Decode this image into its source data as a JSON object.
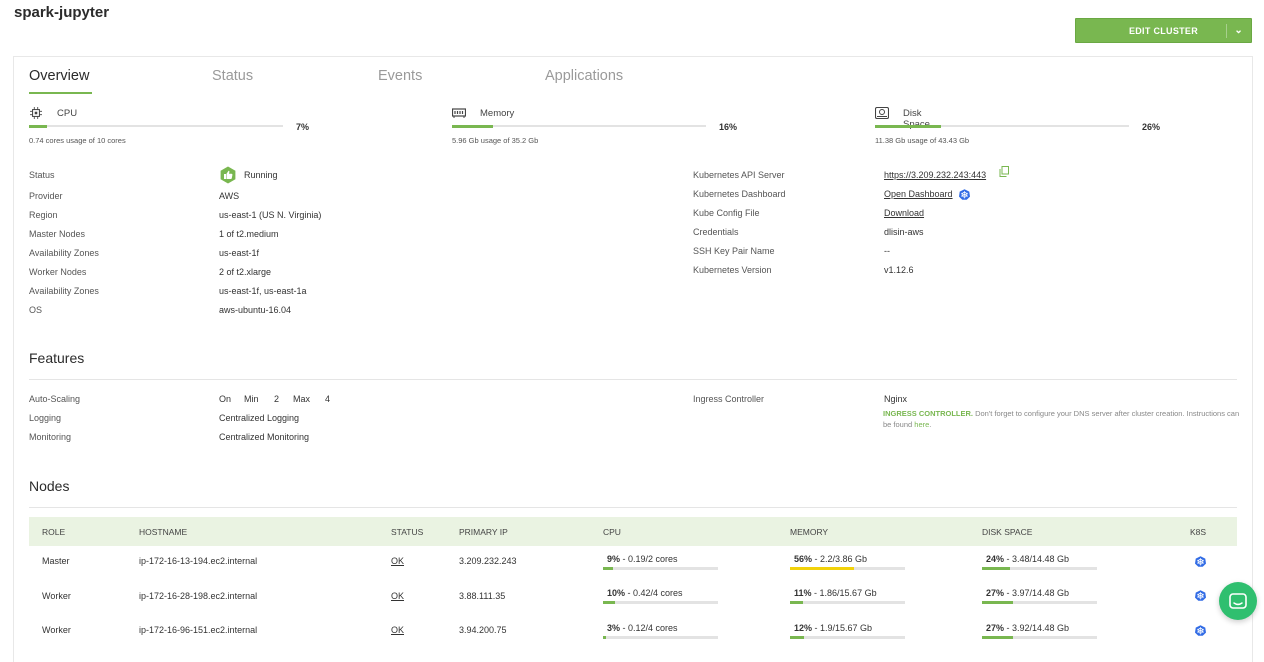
{
  "page": {
    "title": "spark-jupyter"
  },
  "header": {
    "edit_label": "EDIT CLUSTER"
  },
  "tabs": [
    {
      "label": "Overview",
      "active": true
    },
    {
      "label": "Status",
      "active": false
    },
    {
      "label": "Events",
      "active": false
    },
    {
      "label": "Applications",
      "active": false
    }
  ],
  "resources": {
    "cpu": {
      "label": "CPU",
      "percent": "7%",
      "fill": 0.07,
      "usage": "0.74 cores usage of 10 cores"
    },
    "memory": {
      "label": "Memory",
      "percent": "16%",
      "fill": 0.16,
      "usage": "5.96 Gb usage of 35.2 Gb"
    },
    "disk": {
      "label": "Disk Space",
      "percent": "26%",
      "fill": 0.26,
      "usage": "11.38 Gb usage of 43.43 Gb"
    }
  },
  "details_left": [
    {
      "key": "Status",
      "value": "Running"
    },
    {
      "key": "Provider",
      "value": "AWS"
    },
    {
      "key": "Region",
      "value": "us-east-1 (US N. Virginia)"
    },
    {
      "key": "Master Nodes",
      "value": "1 of t2.medium"
    },
    {
      "key": "Availability Zones",
      "value": "us-east-1f"
    },
    {
      "key": "Worker Nodes",
      "value": "2 of t2.xlarge"
    },
    {
      "key": "Availability Zones",
      "value": "us-east-1f, us-east-1a"
    },
    {
      "key": "OS",
      "value": "aws-ubuntu-16.04"
    }
  ],
  "details_right": [
    {
      "key": "Kubernetes API Server",
      "value": "https://3.209.232.243:443"
    },
    {
      "key": "Kubernetes Dashboard",
      "value": "Open Dashboard"
    },
    {
      "key": "Kube Config File",
      "value": "Download"
    },
    {
      "key": "Credentials",
      "value": "dlisin-aws"
    },
    {
      "key": "SSH Key Pair Name",
      "value": "--"
    },
    {
      "key": "Kubernetes Version",
      "value": "v1.12.6"
    }
  ],
  "features": {
    "title": "Features",
    "autoscaling": {
      "key": "Auto-Scaling",
      "on": "On",
      "min_label": "Min",
      "min": "2",
      "max_label": "Max",
      "max": "4"
    },
    "logging": {
      "key": "Logging",
      "value": "Centralized Logging"
    },
    "monitoring": {
      "key": "Monitoring",
      "value": "Centralized Monitoring"
    },
    "ingress": {
      "key": "Ingress Controller",
      "value": "Nginx",
      "note_label": "INGRESS CONTROLLER.",
      "note_text": " Don't forget to configure your DNS server after cluster creation. Instructions can be found ",
      "note_link": "here",
      "note_end": "."
    }
  },
  "nodes": {
    "title": "Nodes",
    "headers": {
      "role": "ROLE",
      "hostname": "HOSTNAME",
      "status": "STATUS",
      "ip": "PRIMARY IP",
      "cpu": "CPU",
      "memory": "MEMORY",
      "disk": "DISK SPACE",
      "k8s": "K8S"
    },
    "rows": [
      {
        "role": "Master",
        "hostname": "ip-172-16-13-194.ec2.internal",
        "status": "OK",
        "ip": "3.209.232.243",
        "cpu_pct": "9%",
        "cpu_txt": " - 0.19/2 cores",
        "cpu_fill": 0.09,
        "mem_pct": "56%",
        "mem_txt": " - 2.2/3.86 Gb",
        "mem_fill": 0.56,
        "mem_color": "#f2d20a",
        "disk_pct": "24%",
        "disk_txt": " - 3.48/14.48 Gb",
        "disk_fill": 0.24
      },
      {
        "role": "Worker",
        "hostname": "ip-172-16-28-198.ec2.internal",
        "status": "OK",
        "ip": "3.88.111.35",
        "cpu_pct": "10%",
        "cpu_txt": " - 0.42/4 cores",
        "cpu_fill": 0.1,
        "mem_pct": "11%",
        "mem_txt": " - 1.86/15.67 Gb",
        "mem_fill": 0.11,
        "mem_color": "#79b750",
        "disk_pct": "27%",
        "disk_txt": " - 3.97/14.48 Gb",
        "disk_fill": 0.27
      },
      {
        "role": "Worker",
        "hostname": "ip-172-16-96-151.ec2.internal",
        "status": "OK",
        "ip": "3.94.200.75",
        "cpu_pct": "3%",
        "cpu_txt": " - 0.12/4 cores",
        "cpu_fill": 0.03,
        "mem_pct": "12%",
        "mem_txt": " - 1.9/15.67 Gb",
        "mem_fill": 0.12,
        "mem_color": "#79b750",
        "disk_pct": "27%",
        "disk_txt": " - 3.92/14.48 Gb",
        "disk_fill": 0.27
      }
    ]
  },
  "colors": {
    "accent": "#79b750",
    "warning": "#f2d20a",
    "k8s": "#326ce5",
    "chat": "#2fbf6f"
  }
}
